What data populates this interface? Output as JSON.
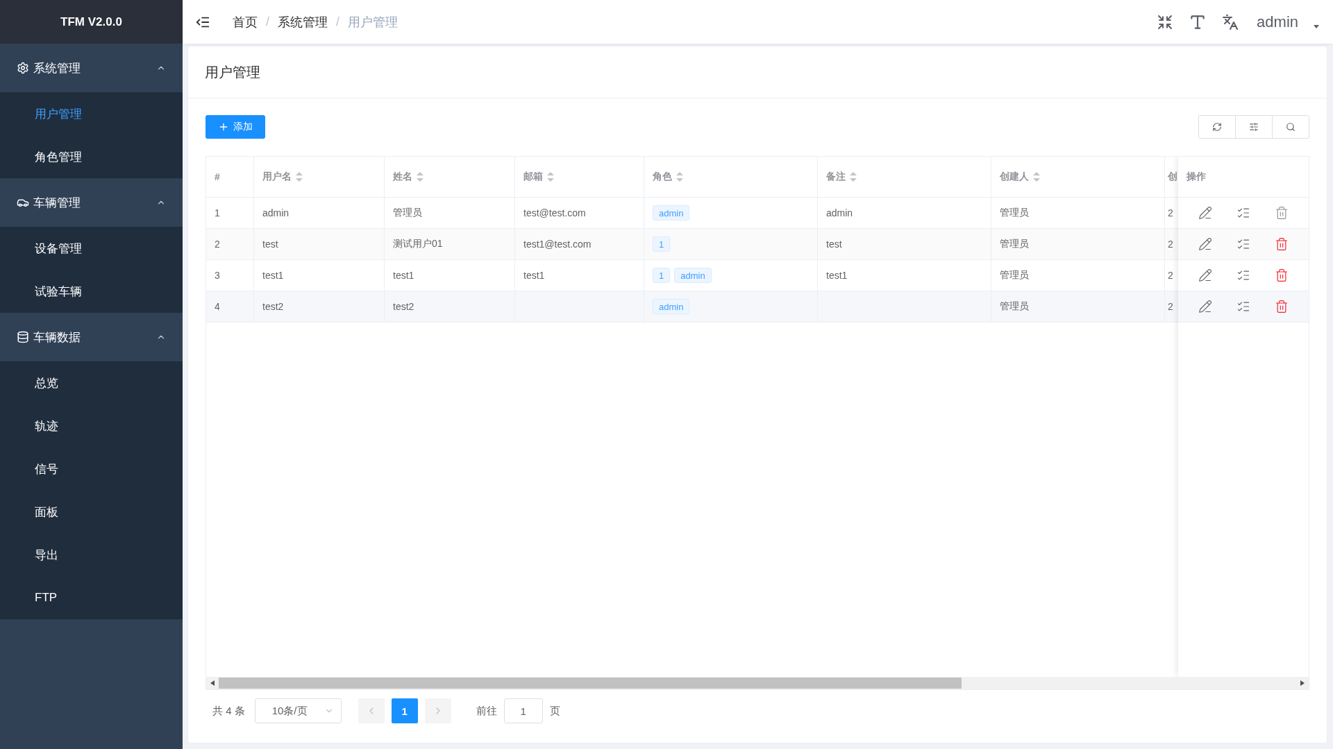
{
  "sidebar": {
    "logo": "TFM V2.0.0",
    "groups": [
      {
        "label": "系统管理",
        "expanded": true,
        "items": [
          {
            "label": "用户管理",
            "selected": true
          },
          {
            "label": "角色管理",
            "selected": false
          }
        ]
      },
      {
        "label": "车辆管理",
        "expanded": true,
        "items": [
          {
            "label": "设备管理",
            "selected": false
          },
          {
            "label": "试验车辆",
            "selected": false
          }
        ]
      },
      {
        "label": "车辆数据",
        "expanded": true,
        "items": [
          {
            "label": "总览",
            "selected": false
          },
          {
            "label": "轨迹",
            "selected": false
          },
          {
            "label": "信号",
            "selected": false
          },
          {
            "label": "面板",
            "selected": false
          },
          {
            "label": "导出",
            "selected": false
          },
          {
            "label": "FTP",
            "selected": false
          }
        ]
      }
    ]
  },
  "header": {
    "breadcrumb": [
      "首页",
      "系统管理",
      "用户管理"
    ],
    "separator": "/",
    "user": "admin"
  },
  "page": {
    "title": "用户管理",
    "add_button": "添加"
  },
  "table": {
    "columns": [
      {
        "label": "#"
      },
      {
        "label": "用户名",
        "sortable": true
      },
      {
        "label": "姓名",
        "sortable": true
      },
      {
        "label": "邮箱",
        "sortable": true
      },
      {
        "label": "角色",
        "sortable": true
      },
      {
        "label": "备注",
        "sortable": true
      },
      {
        "label": "创建人",
        "sortable": true
      },
      {
        "label": "创"
      }
    ],
    "action_column": "操作",
    "rows": [
      {
        "cells": [
          "1",
          "admin",
          "管理员",
          "test@test.com"
        ],
        "roles": [
          "admin"
        ],
        "note": "admin",
        "creator": "管理员",
        "column_8": "2",
        "delete_disabled": true
      },
      {
        "cells": [
          "2",
          "test",
          "测试用户01",
          "test1@test.com"
        ],
        "roles": [
          "1"
        ],
        "note": "test",
        "creator": "管理员",
        "column_8": "2",
        "delete_disabled": false
      },
      {
        "cells": [
          "3",
          "test1",
          "test1",
          "test1"
        ],
        "roles": [
          "1",
          "admin"
        ],
        "note": "test1",
        "creator": "管理员",
        "column_8": "2",
        "delete_disabled": false
      },
      {
        "cells": [
          "4",
          "test2",
          "test2",
          ""
        ],
        "roles": [
          "admin"
        ],
        "note": "",
        "creator": "管理员",
        "column_8": "2",
        "delete_disabled": false
      }
    ]
  },
  "pagination": {
    "total": "共 4 条",
    "page_size": "10条/页",
    "pages": [
      {
        "label": "1",
        "selected": true
      }
    ],
    "goto_label": "前往",
    "goto_value": "1",
    "goto_suffix": "页"
  }
}
